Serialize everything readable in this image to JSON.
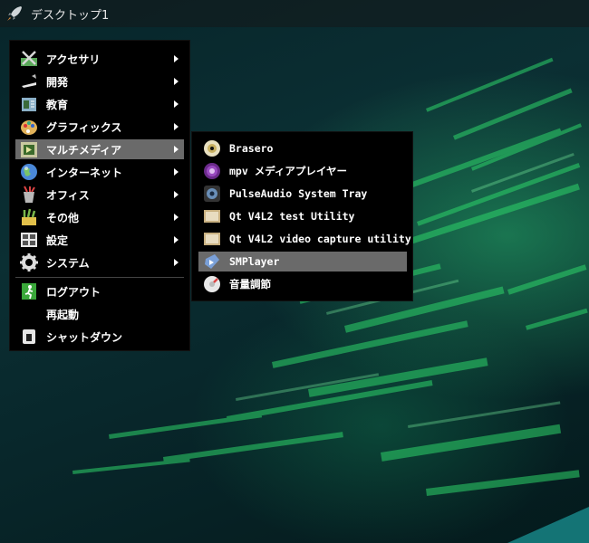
{
  "panel": {
    "title": "デスクトップ1",
    "launcher_icon": "rocket-icon"
  },
  "main_menu": {
    "items": [
      {
        "label": "アクセサリ",
        "icon": "accessories-icon",
        "has_submenu": true
      },
      {
        "label": "開発",
        "icon": "development-icon",
        "has_submenu": true
      },
      {
        "label": "教育",
        "icon": "education-icon",
        "has_submenu": true
      },
      {
        "label": "グラフィックス",
        "icon": "graphics-icon",
        "has_submenu": true
      },
      {
        "label": "マルチメディア",
        "icon": "multimedia-icon",
        "has_submenu": true,
        "highlighted": true
      },
      {
        "label": "インターネット",
        "icon": "internet-icon",
        "has_submenu": true
      },
      {
        "label": "オフィス",
        "icon": "office-icon",
        "has_submenu": true
      },
      {
        "label": "その他",
        "icon": "other-icon",
        "has_submenu": true
      },
      {
        "label": "設定",
        "icon": "settings-icon",
        "has_submenu": true
      },
      {
        "label": "システム",
        "icon": "system-icon",
        "has_submenu": true
      }
    ],
    "session": [
      {
        "label": "ログアウト",
        "icon": "logout-icon"
      },
      {
        "label": "再起動",
        "icon": ""
      },
      {
        "label": "シャットダウン",
        "icon": "shutdown-icon"
      }
    ]
  },
  "multimedia_menu": {
    "items": [
      {
        "label": "Brasero",
        "icon": "disc-icon"
      },
      {
        "label": "mpv メディアプレイヤー",
        "icon": "mpv-icon"
      },
      {
        "label": "PulseAudio System Tray",
        "icon": "speaker-icon"
      },
      {
        "label": "Qt V4L2 test Utility",
        "icon": "video-capture-icon"
      },
      {
        "label": "Qt V4L2 video capture utility",
        "icon": "video-capture-icon"
      },
      {
        "label": "SMPlayer",
        "icon": "smplayer-icon",
        "highlighted": true
      },
      {
        "label": "音量調節",
        "icon": "volume-icon"
      }
    ]
  },
  "colors": {
    "menu_bg": "#000000",
    "highlight": "#6a6a6a",
    "wallpaper_green": "#2fd46a"
  }
}
